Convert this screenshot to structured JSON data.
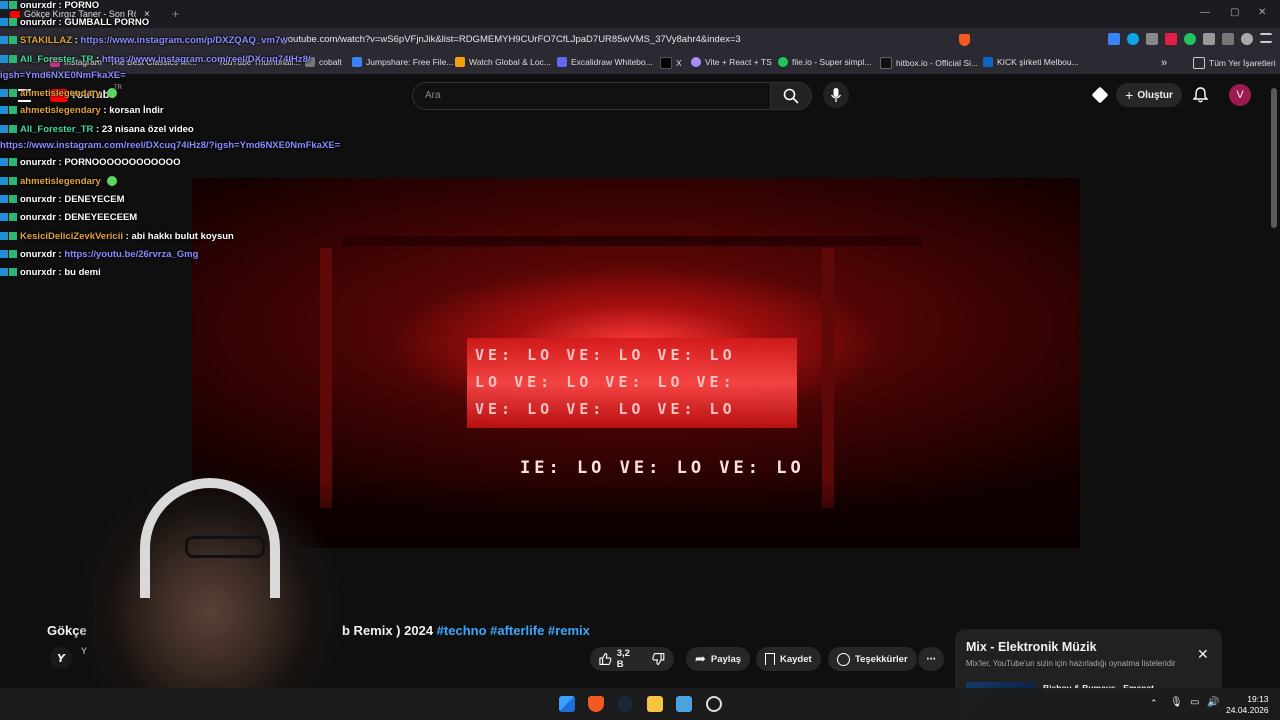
{
  "browser": {
    "tab_title": "Gökçe Kırgız Taner - Son Rötuş (",
    "tab_close": "×",
    "new_tab": "+",
    "url": "youtube.com/watch?v=wS6pVFjnJik&list=RDGMEMYH9CUrFO7CfLJpaD7UR85wVMS_37Vy8ahr4&index=3",
    "bookmarks": [
      "Instagram",
      "The Best Classics an...",
      "YouTube Thumbnail...",
      "cobalt",
      "Jumpshare: Free File...",
      "Watch Global & Loc...",
      "Excalidraw Whitebo...",
      "X",
      "Vite + React + TS",
      "file.io - Super simpl...",
      "hitbox.io - Official Si...",
      "KICK şirketi Melbou..."
    ],
    "bookmarks_more": "»",
    "all_bookmarks": "Tüm Yer İşaretleri"
  },
  "youtube": {
    "logo": "YouTube",
    "logo_suffix": "TR",
    "search_placeholder": "Ara",
    "create_label": "Oluştur",
    "avatar_letter": "V",
    "title_left": "Gökçe",
    "title_right": "b Remix ) 2024",
    "title_tags": "#techno #afterlife #remix",
    "channel_initial": "Y",
    "like_count": "3,2 B",
    "share_label": "Paylaş",
    "save_label": "Kaydet",
    "thanks_label": "Teşekkürler",
    "more_label": "⋯",
    "mix_title": "Mix - Elektronik Müzik",
    "mix_subtitle": "Mix'ler, YouTube'un sizin için hazırladığı oynatma listeleridir",
    "mix_close": "✕",
    "mix_item": "Bishov & Bumaus - Emanet"
  },
  "video_overlay": {
    "screen_rows": [
      "VE: LO VE: LO VE: LO",
      "LO VE: LO VE: LO VE:",
      "VE: LO VE: LO VE: LO"
    ],
    "bottom_text": "IE: LO VE: LO VE: LO"
  },
  "chat": [
    {
      "user": "onurxdr",
      "msg": "PORNO",
      "color": "white",
      "link": false
    },
    {
      "user": "onurxdr",
      "msg": "GUMBALL PORNO",
      "color": "white",
      "link": false
    },
    {
      "user": "STAKILLAZ",
      "msg": "https://www.instagram.com/p/DXZQAQ_vm7w",
      "color": "gold",
      "link": true
    },
    {
      "user": "All_Forester_TR",
      "msg": "https://www.instagram.com/reel/DXcuq74IHz8/",
      "color": "green",
      "link": true
    },
    {
      "user": "",
      "msg": "igsh=Ymd6NXE0NmFkaXE=",
      "color": "gold",
      "link": true
    },
    {
      "user": "ahmetislegendary",
      "msg": "",
      "color": "gold",
      "link": false
    },
    {
      "user": "ahmetislegendary",
      "msg": "korsan İndir",
      "color": "gold",
      "link": false
    },
    {
      "user": "All_Forester_TR",
      "msg": "23 nisana özel video",
      "color": "green",
      "link": false
    },
    {
      "user": "",
      "msg": "https://www.instagram.com/reel/DXcuq74iHz8/?igsh=Ymd6NXE0NmFkaXE=",
      "color": "gold",
      "link": true
    },
    {
      "user": "onurxdr",
      "msg": "PORNOOOOOOOOOOOO",
      "color": "white",
      "link": false
    },
    {
      "user": "ahmetislegendary",
      "msg": "",
      "color": "gold",
      "link": false
    },
    {
      "user": "onurxdr",
      "msg": "DENEYECEM",
      "color": "white",
      "link": false
    },
    {
      "user": "onurxdr",
      "msg": "DENEYEECEEM",
      "color": "white",
      "link": false
    },
    {
      "user": "KesiciDeliciZevkVericii",
      "msg": "abi hakkı bulut koysun",
      "color": "gold",
      "link": false
    },
    {
      "user": "onurxdr",
      "msg": "https://youtu.be/26rvrza_Gmg",
      "color": "white",
      "link": true
    },
    {
      "user": "onurxdr",
      "msg": "bu demi",
      "color": "white",
      "link": false
    }
  ],
  "taskbar": {
    "time": "19:13",
    "date": "24.04.2026"
  },
  "colors": {
    "accent_link": "#3ea6ff",
    "stage_red": "#ff3a3a",
    "avatar": "#9b1b4e"
  }
}
